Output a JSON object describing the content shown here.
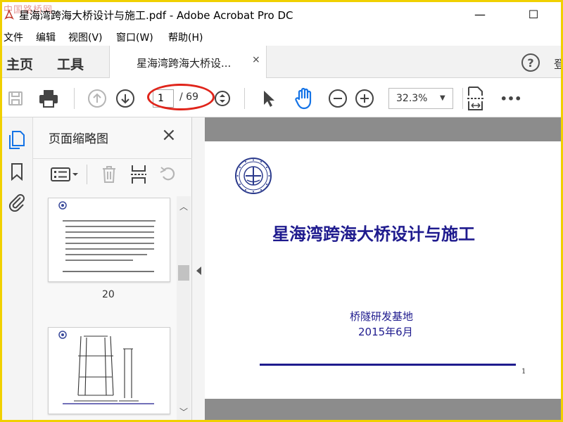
{
  "titlebar": {
    "title": "星海湾跨海大桥设计与施工.pdf - Adobe Acrobat Pro DC",
    "watermark": "中国路桥网",
    "minimize": "—",
    "maximize": "☐"
  },
  "menu": {
    "file": "文件",
    "edit": "编辑",
    "view": "视图(V)",
    "window": "窗口(W)",
    "help": "帮助(H)"
  },
  "tabs": {
    "home": "主页",
    "tools": "工具",
    "doc": "星海湾跨海大桥设...",
    "doc_close": "×",
    "help": "?",
    "signin": "登"
  },
  "toolbar": {
    "page_current": "1",
    "page_total": "/ 69",
    "zoom": "32.3%",
    "more": "•••"
  },
  "panel": {
    "title": "页面缩略图",
    "close": "×",
    "thumbs": [
      {
        "label": "20"
      },
      {
        "label": ""
      }
    ]
  },
  "document": {
    "title": "星海湾跨海大桥设计与施工",
    "org": "桥隧研发基地",
    "date": "2015年6月",
    "page_number": "1"
  },
  "colors": {
    "doc_title": "#1f1b8e",
    "annotation": "#e0241a",
    "hand_tool": "#1473e6"
  }
}
